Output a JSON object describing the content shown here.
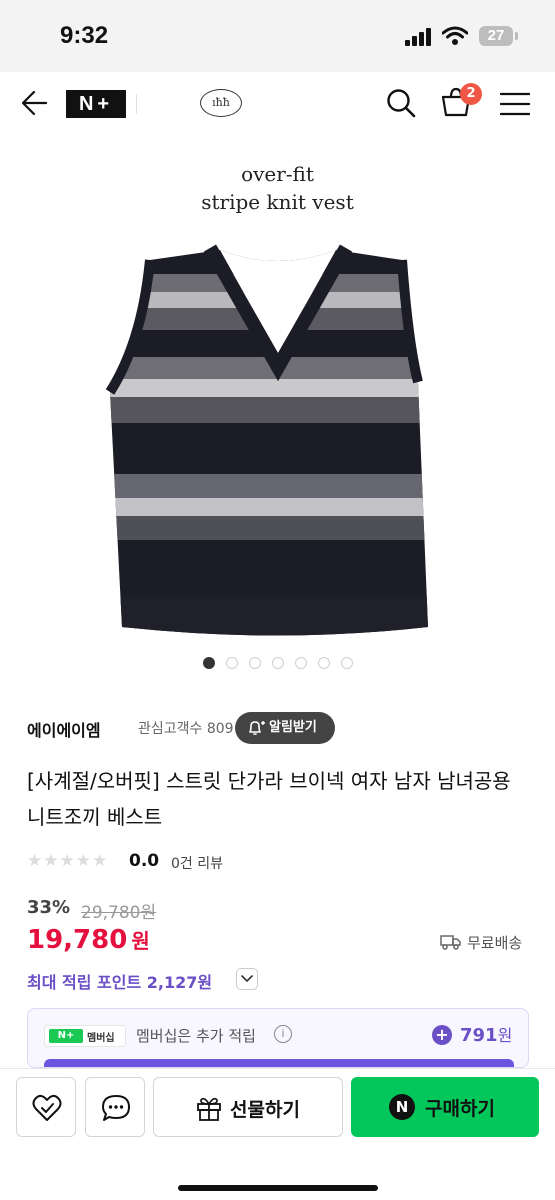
{
  "status_bar": {
    "time": "9:32",
    "battery": "27"
  },
  "header": {
    "logo": "N+",
    "brand_logo": "ıħħ",
    "cart_count": "2",
    "icons": [
      "back-arrow-icon",
      "search-icon",
      "cart-icon",
      "menu-icon"
    ]
  },
  "image": {
    "caption_line1": "over-fit",
    "caption_line2": "stripe knit vest",
    "page_count": 7,
    "active_page": 1
  },
  "seller": {
    "name": "에이에이엠",
    "fans": "관심고객수 809",
    "alarm_label": "알림받기"
  },
  "product": {
    "title": "[사계절/오버핏] 스트릿 단가라 브이넥 여자 남자 남녀공용 니트조끼 베스트",
    "stars": "★★★★★",
    "rating": "0.0",
    "reviews": "0건 리뷰",
    "discount_rate": "33%",
    "original_price": "29,780원",
    "sale_price": "19,780",
    "price_unit": "원",
    "shipping": "무료배송",
    "max_points": "최대 적립 포인트 2,127원"
  },
  "membership": {
    "badge_logo": "N+",
    "badge_label": "멤버십",
    "text": "멤버십은 추가 적립",
    "info": "i",
    "plus": "+",
    "points": "791",
    "points_unit": "원"
  },
  "actions": {
    "gift_label": "선물하기",
    "buy_label": "구매하기",
    "buy_badge": "N"
  },
  "colors": {
    "sale_red": "#e5103e",
    "points_purple": "#6a4fc7",
    "buy_green": "#03c75a",
    "badge_orange": "#f15746"
  }
}
